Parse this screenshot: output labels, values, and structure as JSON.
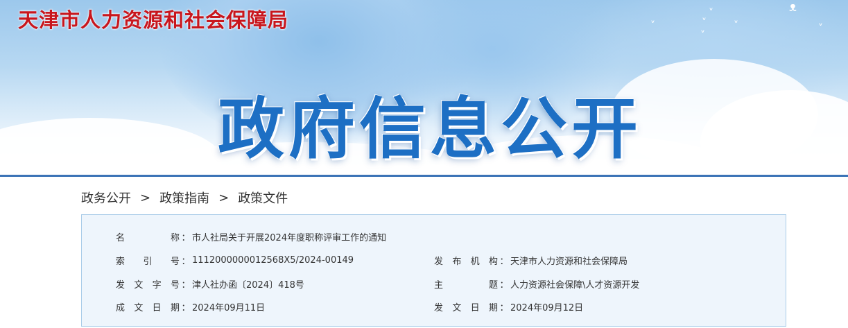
{
  "header": {
    "site_title": "天津市人力资源和社会保障局",
    "banner_headline": "政府信息公开",
    "bird_icon": "bird-icon"
  },
  "breadcrumb": {
    "items": [
      "政务公开",
      "政策指南",
      "政策文件"
    ],
    "separator": ">"
  },
  "document_info": {
    "colon": "：",
    "name": {
      "label": "名称",
      "value": "市人社局关于开展2024年度职称评审工作的通知"
    },
    "index_number": {
      "label": "索引号",
      "value": "1112000000012568X5/2024-00149"
    },
    "publisher": {
      "label": "发布机构",
      "value": "天津市人力资源和社会保障局"
    },
    "doc_number": {
      "label": "发文字号",
      "value": "津人社办函〔2024〕418号"
    },
    "subject": {
      "label": "主题",
      "value": "人力资源社会保障\\人才资源开发"
    },
    "created_date": {
      "label": "成文日期",
      "value": "2024年09月11日"
    },
    "issue_date": {
      "label": "发文日期",
      "value": "2024年09月12日"
    }
  },
  "colors": {
    "site_title": "#c8161d",
    "banner_headline": "#1d6fc4",
    "divider": "#3b73b6",
    "info_box_bg": "#eef5fc",
    "info_box_border": "#a8cbe8"
  }
}
